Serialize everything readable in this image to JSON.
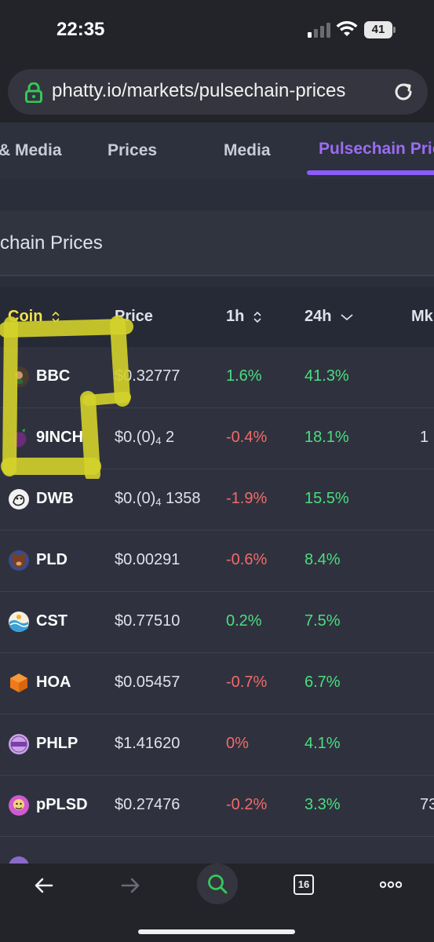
{
  "status": {
    "time": "22:35",
    "battery": "41"
  },
  "url_bar": {
    "url": "phatty.io/markets/pulsechain-prices"
  },
  "nav_tabs": [
    {
      "label": "& Media"
    },
    {
      "label": "Prices"
    },
    {
      "label": "Media"
    },
    {
      "label": "Pulsechain Prices"
    }
  ],
  "section": {
    "title": "chain Prices"
  },
  "table": {
    "headers": {
      "coin": "Coin",
      "price": "Price",
      "h1": "1h",
      "h24": "24h",
      "mkt": "Mk"
    },
    "rows": [
      {
        "symbol": "BBC",
        "price": "$0.32777",
        "h1": "1.6%",
        "h24": "41.3%",
        "mkt": "",
        "icon": "bbc-coin-icon",
        "color": "#4a3b2e"
      },
      {
        "symbol": "9INCH",
        "price_base": "$0.(0)",
        "price_sub": "4",
        "price_tail": " 2",
        "h1": "-0.4%",
        "h24": "18.1%",
        "mkt": "1",
        "icon": "9inch-coin-icon",
        "color": "#6b2c7a"
      },
      {
        "symbol": "DWB",
        "price_base": "$0.(0)",
        "price_sub": "4",
        "price_tail": " 1358",
        "h1": "-1.9%",
        "h24": "15.5%",
        "mkt": "",
        "icon": "dwb-coin-icon",
        "color": "#f2f2f2"
      },
      {
        "symbol": "PLD",
        "price": "$0.00291",
        "h1": "-0.6%",
        "h24": "8.4%",
        "mkt": "",
        "icon": "pld-coin-icon",
        "color": "#7a3f1e"
      },
      {
        "symbol": "CST",
        "price": "$0.77510",
        "h1": "0.2%",
        "h24": "7.5%",
        "mkt": "",
        "icon": "cst-coin-icon",
        "color": "#3aa0d8"
      },
      {
        "symbol": "HOA",
        "price": "$0.05457",
        "h1": "-0.7%",
        "h24": "6.7%",
        "mkt": "",
        "icon": "hoa-coin-icon",
        "color": "#f07a1a"
      },
      {
        "symbol": "PHLP",
        "price": "$1.41620",
        "h1": "0%",
        "h24": "4.1%",
        "mkt": "",
        "icon": "phlp-coin-icon",
        "color": "#c9a3e6"
      },
      {
        "symbol": "pPLSD",
        "price": "$0.27476",
        "h1": "-0.2%",
        "h24": "3.3%",
        "mkt": "73",
        "icon": "pplsd-coin-icon",
        "color": "#d05ad0"
      }
    ]
  },
  "toolbar": {
    "tab_count": "16"
  },
  "colors": {
    "accent": "#8b5cf6",
    "positive": "#4ade80",
    "negative": "#f26a6a",
    "highlight": "#d4d22a"
  }
}
